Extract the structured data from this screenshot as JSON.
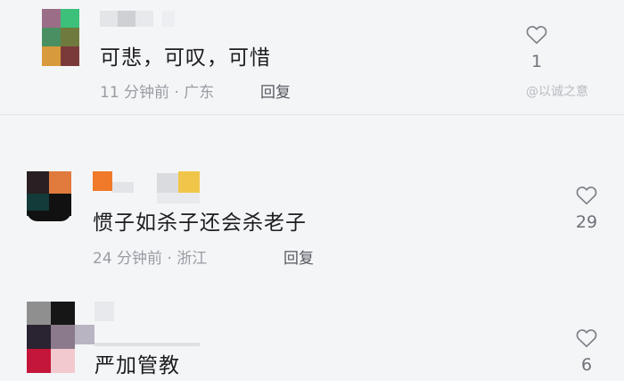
{
  "comments": [
    {
      "text": "可悲，可叹，可惜",
      "time": "11 分钟前",
      "location": "广东",
      "reply_label": "回复",
      "likes": "1",
      "avatar_colors": [
        "#9b6d86",
        "#3cc07a",
        "#4a8f62",
        "#6f7a3e",
        "#d79a3c",
        "#7b3a3a"
      ]
    },
    {
      "text": "惯子如杀子还会杀老子",
      "time": "24 分钟前",
      "location": "浙江",
      "reply_label": "回复",
      "likes": "29",
      "avatar_colors": [
        "#2a1f22",
        "#e07a3d",
        "#123b3a",
        "#111111"
      ]
    },
    {
      "text": "严加管教",
      "time": "",
      "location": "",
      "reply_label": "",
      "likes": "6",
      "avatar_colors": [
        "#8f8f8f",
        "#161616",
        "#8a7a8c",
        "#2a2332",
        "#e8a8b8",
        "#c4163b",
        "#f2c9cf"
      ]
    }
  ],
  "watermark": "@以诚之意",
  "colors": {
    "background": "#f4f5f7",
    "text": "#1d1d1f",
    "meta": "#9a9ca3",
    "heart_outline": "#7d8087"
  },
  "icons": {
    "like": "heart-outline-icon"
  }
}
